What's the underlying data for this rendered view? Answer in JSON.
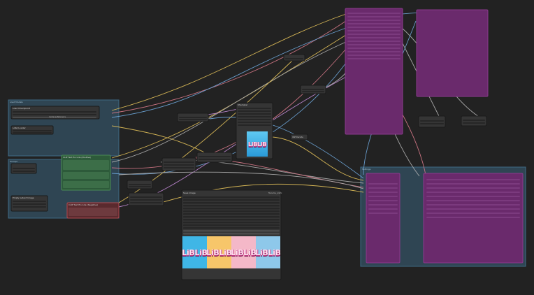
{
  "canvas": {
    "background": "#222222",
    "wire_colors": [
      "#e6c35a",
      "#d97a8a",
      "#6fa8dc",
      "#b5b5b5",
      "#c48bd8"
    ]
  },
  "groups": {
    "top": {
      "title": "Load Models"
    },
    "bottom": {
      "title": "Prompt"
    },
    "right": {
      "title": "Settings"
    }
  },
  "nodes": {
    "checkpoint": {
      "title": "Load Checkpoint",
      "widget": "model.safetensors"
    },
    "lora": {
      "title": "LoRA Loader"
    },
    "positive": {
      "title": "CLIP Text Encode (Positive)"
    },
    "negative": {
      "title": "CLIP Text Encode (Negative)"
    },
    "sampler": {
      "title": "KSampler"
    },
    "preview": {
      "title": "Preview Image"
    },
    "batch": {
      "title": "Save Image",
      "label_right": "filename_prefix"
    },
    "vae": {
      "title": "VAE Decode"
    },
    "latent": {
      "title": "Empty Latent Image"
    }
  },
  "images": {
    "preview_logo": "LiBLiB",
    "batch_logos": [
      "LiBLiB",
      "LiBLiB",
      "LiBLiB",
      "LiBLiB"
    ]
  },
  "batch_colors": [
    "#3fb6e6",
    "#f7c66a",
    "#f4b8c8",
    "#8ec8ea"
  ]
}
